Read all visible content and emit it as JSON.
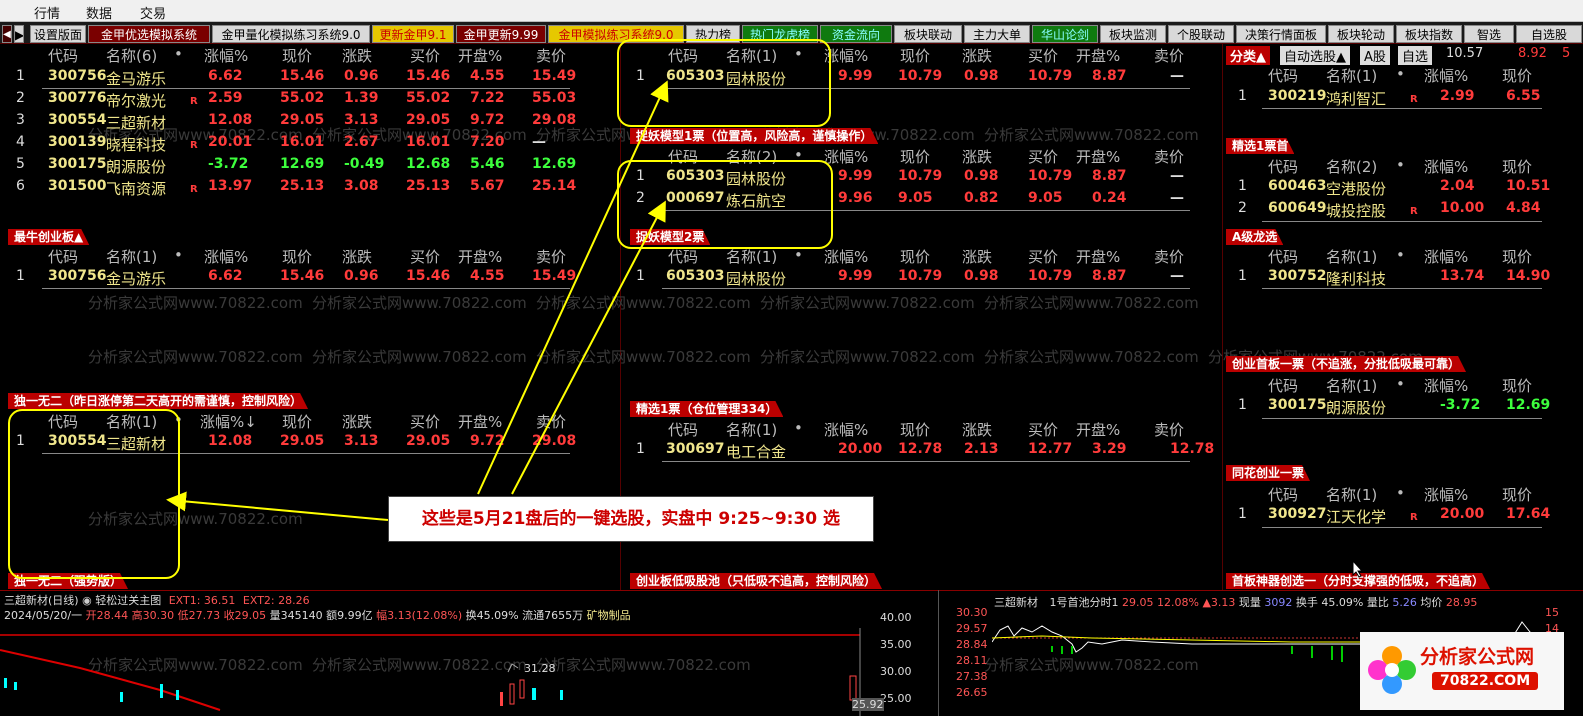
{
  "menu": [
    "行情",
    "数据",
    "交易"
  ],
  "tabs": [
    {
      "label": "设置版面",
      "style": "normal",
      "w": 0
    },
    {
      "label": "金甲优选模拟系统",
      "style": "dark"
    },
    {
      "label": "金甲量化模拟练习系统9.0",
      "style": "normal"
    },
    {
      "label": "更新金甲9.1",
      "style": "yellow"
    },
    {
      "label": "金甲更新9.99",
      "style": "dark"
    },
    {
      "label": "金甲模拟练习系统9.0",
      "style": "yellow"
    },
    {
      "label": "热力榜",
      "style": "normal"
    },
    {
      "label": "热门龙虎榜",
      "style": "green"
    },
    {
      "label": "资金流向",
      "style": "green"
    },
    {
      "label": "板块联动",
      "style": "normal"
    },
    {
      "label": "主力大单",
      "style": "normal"
    },
    {
      "label": "华山论剑",
      "style": "green"
    },
    {
      "label": "板块监测",
      "style": "normal"
    },
    {
      "label": "个股联动",
      "style": "normal"
    },
    {
      "label": "决策行情面板",
      "style": "normal"
    },
    {
      "label": "板块轮动",
      "style": "normal"
    },
    {
      "label": "板块指数",
      "style": "normal"
    },
    {
      "label": "智选",
      "style": "normal"
    },
    {
      "label": "自选股",
      "style": "normal"
    }
  ],
  "col_headers": {
    "code": "代码",
    "pct": "涨幅%",
    "price": "现价",
    "chg": "涨跌",
    "bid": "买价",
    "open": "开盘%",
    "ask": "卖价"
  },
  "panels": {
    "p1": {
      "name_hdr": "名称(6)",
      "title": "",
      "rows": [
        {
          "i": "1",
          "code": "300756",
          "name": "金马游乐",
          "r": "",
          "pct": "6.62",
          "price": "15.46",
          "chg": "0.96",
          "bid": "15.46",
          "open": "4.55",
          "ask": "15.49",
          "dir": "up"
        },
        {
          "i": "2",
          "code": "300776",
          "name": "帝尔激光",
          "r": "R",
          "pct": "2.59",
          "price": "55.02",
          "chg": "1.39",
          "bid": "55.02",
          "open": "7.22",
          "ask": "55.03",
          "dir": "up"
        },
        {
          "i": "3",
          "code": "300554",
          "name": "三超新材",
          "r": "",
          "pct": "12.08",
          "price": "29.05",
          "chg": "3.13",
          "bid": "29.05",
          "open": "9.72",
          "ask": "29.08",
          "dir": "up"
        },
        {
          "i": "4",
          "code": "300139",
          "name": "晓程科技",
          "r": "R",
          "pct": "20.01",
          "price": "16.01",
          "chg": "2.67",
          "bid": "16.01",
          "open": "7.20",
          "ask": "—",
          "dir": "up"
        },
        {
          "i": "5",
          "code": "300175",
          "name": "朗源股份",
          "r": "",
          "pct": "-3.72",
          "price": "12.69",
          "chg": "-0.49",
          "bid": "12.68",
          "open": "5.46",
          "ask": "12.69",
          "dir": "down"
        },
        {
          "i": "6",
          "code": "301500",
          "name": "飞南资源",
          "r": "R",
          "pct": "13.97",
          "price": "25.13",
          "chg": "3.08",
          "bid": "25.13",
          "open": "5.67",
          "ask": "25.14",
          "dir": "up"
        }
      ]
    },
    "p2": {
      "title": "最牛创业板▲",
      "name_hdr": "名称(1)",
      "rows": [
        {
          "i": "1",
          "code": "300756",
          "name": "金马游乐",
          "r": "",
          "pct": "6.62",
          "price": "15.46",
          "chg": "0.96",
          "bid": "15.46",
          "open": "4.55",
          "ask": "15.49",
          "dir": "up"
        }
      ]
    },
    "p3": {
      "title": "独一无二（昨日涨停第二天高开的需谨慎，控制风险）",
      "name_hdr": "名称(1)",
      "pct_hdr": "涨幅%↓",
      "rows": [
        {
          "i": "1",
          "code": "300554",
          "name": "三超新材",
          "r": "",
          "pct": "12.08",
          "price": "29.05",
          "chg": "3.13",
          "bid": "29.05",
          "open": "9.72",
          "ask": "29.08",
          "dir": "up"
        }
      ]
    },
    "p4_title": "独一无二（强势版）",
    "m1": {
      "name_hdr": "名称(1)",
      "rows": [
        {
          "i": "1",
          "code": "605303",
          "name": "园林股份",
          "pct": "9.99",
          "price": "10.79",
          "chg": "0.98",
          "bid": "10.79",
          "open": "8.87",
          "ask": "—",
          "dir": "up"
        }
      ]
    },
    "m2": {
      "title": "捉妖模型1票（位置高，风险高，谨慎操作）",
      "name_hdr": "名称(2)",
      "rows": [
        {
          "i": "1",
          "code": "605303",
          "name": "园林股份",
          "pct": "9.99",
          "price": "10.79",
          "chg": "0.98",
          "bid": "10.79",
          "open": "8.87",
          "ask": "—",
          "dir": "up"
        },
        {
          "i": "2",
          "code": "000697",
          "name": "炼石航空",
          "pct": "9.96",
          "price": "9.05",
          "chg": "0.82",
          "bid": "9.05",
          "open": "0.24",
          "ask": "—",
          "dir": "up"
        }
      ]
    },
    "m3": {
      "title": "捉妖模型2票",
      "name_hdr": "名称(1)",
      "rows": [
        {
          "i": "1",
          "code": "605303",
          "name": "园林股份",
          "pct": "9.99",
          "price": "10.79",
          "chg": "0.98",
          "bid": "10.79",
          "open": "8.87",
          "ask": "—",
          "dir": "up"
        }
      ]
    },
    "m4": {
      "title": "精选1票（仓位管理334）",
      "name_hdr": "名称(1)",
      "rows": [
        {
          "i": "1",
          "code": "300697",
          "name": "电工合金",
          "pct": "20.00",
          "price": "12.78",
          "chg": "2.13",
          "bid": "12.77",
          "open": "3.29",
          "ask": "12.78",
          "dir": "up"
        }
      ]
    },
    "m5_title": "创业板低吸股池（只低吸不追高，控制风险）",
    "r0": {
      "top": {
        "fen": "分类▲",
        "auto": "自动选股▲",
        "agu": "A股",
        "zx": "自选",
        "v1": "10.57",
        "v2": "8.92",
        "v3": "5"
      },
      "name_hdr": "名称(1)",
      "rows": [
        {
          "i": "1",
          "code": "300219",
          "name": "鸿利智汇",
          "r": "R",
          "pct": "2.99",
          "price": "6.55",
          "dir": "up"
        }
      ]
    },
    "r1": {
      "title": "精选1票首",
      "name_hdr": "名称(2)",
      "rows": [
        {
          "i": "1",
          "code": "600463",
          "name": "空港股份",
          "r": "",
          "pct": "2.04",
          "price": "10.51",
          "dir": "up"
        },
        {
          "i": "2",
          "code": "600649",
          "name": "城投控股",
          "r": "R",
          "pct": "10.00",
          "price": "4.84",
          "dir": "up"
        }
      ]
    },
    "r2": {
      "title": "A级龙选",
      "name_hdr": "名称(1)",
      "rows": [
        {
          "i": "1",
          "code": "300752",
          "name": "隆利科技",
          "r": "",
          "pct": "13.74",
          "price": "14.90",
          "dir": "up"
        }
      ]
    },
    "r3": {
      "title": "创业首板一票（不追涨，分批低吸最可靠）",
      "name_hdr": "名称(1)",
      "rows": [
        {
          "i": "1",
          "code": "300175",
          "name": "朗源股份",
          "r": "",
          "pct": "-3.72",
          "price": "12.69",
          "dir": "down"
        }
      ]
    },
    "r4": {
      "title": "同花创业一票",
      "name_hdr": "名称(1)",
      "rows": [
        {
          "i": "1",
          "code": "300927",
          "name": "江天化学",
          "r": "R",
          "pct": "20.00",
          "price": "17.64",
          "dir": "up"
        }
      ]
    },
    "r5_title": "首板神器创选一（分时支撑强的低吸，不追高）"
  },
  "callout": "这些是5月21盘后的一键选股，实盘中 9:25~9:30 选",
  "watermark": "分析家公式网www.70822.com",
  "kline": {
    "title": "三超新材(日线)",
    "indicator": "轻松过关主图",
    "ext1": "EXT1: 36.51",
    "ext2": "EXT2: 28.26",
    "date": "2024/05/20/一",
    "open": "开28.44",
    "high": "高30.30",
    "low": "低27.73",
    "close": "收29.05",
    "vol": "量345140",
    "amt": "额9.99亿",
    "amp": "幅3.13(12.08%)",
    "turn": "换45.09%",
    "float": "流通7655万",
    "sector": "矿物制品",
    "yticks": [
      "40.00",
      "35.00",
      "30.00",
      "25.00"
    ],
    "peak": "31.28",
    "low_label": "25.92"
  },
  "tline": {
    "name": "三超新材",
    "title": "1号首池分时1",
    "price": "29.05",
    "pct": "12.08%",
    "chg": "▲3.13",
    "vol_label": "现量",
    "vol": "3092",
    "turn": "换手 45.09%",
    "ratio_label": "量比",
    "ratio": "5.26",
    "avg_label": "均价",
    "avg": "28.95",
    "yticks": [
      "30.30",
      "29.57",
      "28.84",
      "28.11",
      "27.38",
      "26.65"
    ],
    "rticks": [
      "15",
      "14",
      "11"
    ]
  },
  "logo": {
    "name": "分析家公式网",
    "url": "70822.COM"
  }
}
